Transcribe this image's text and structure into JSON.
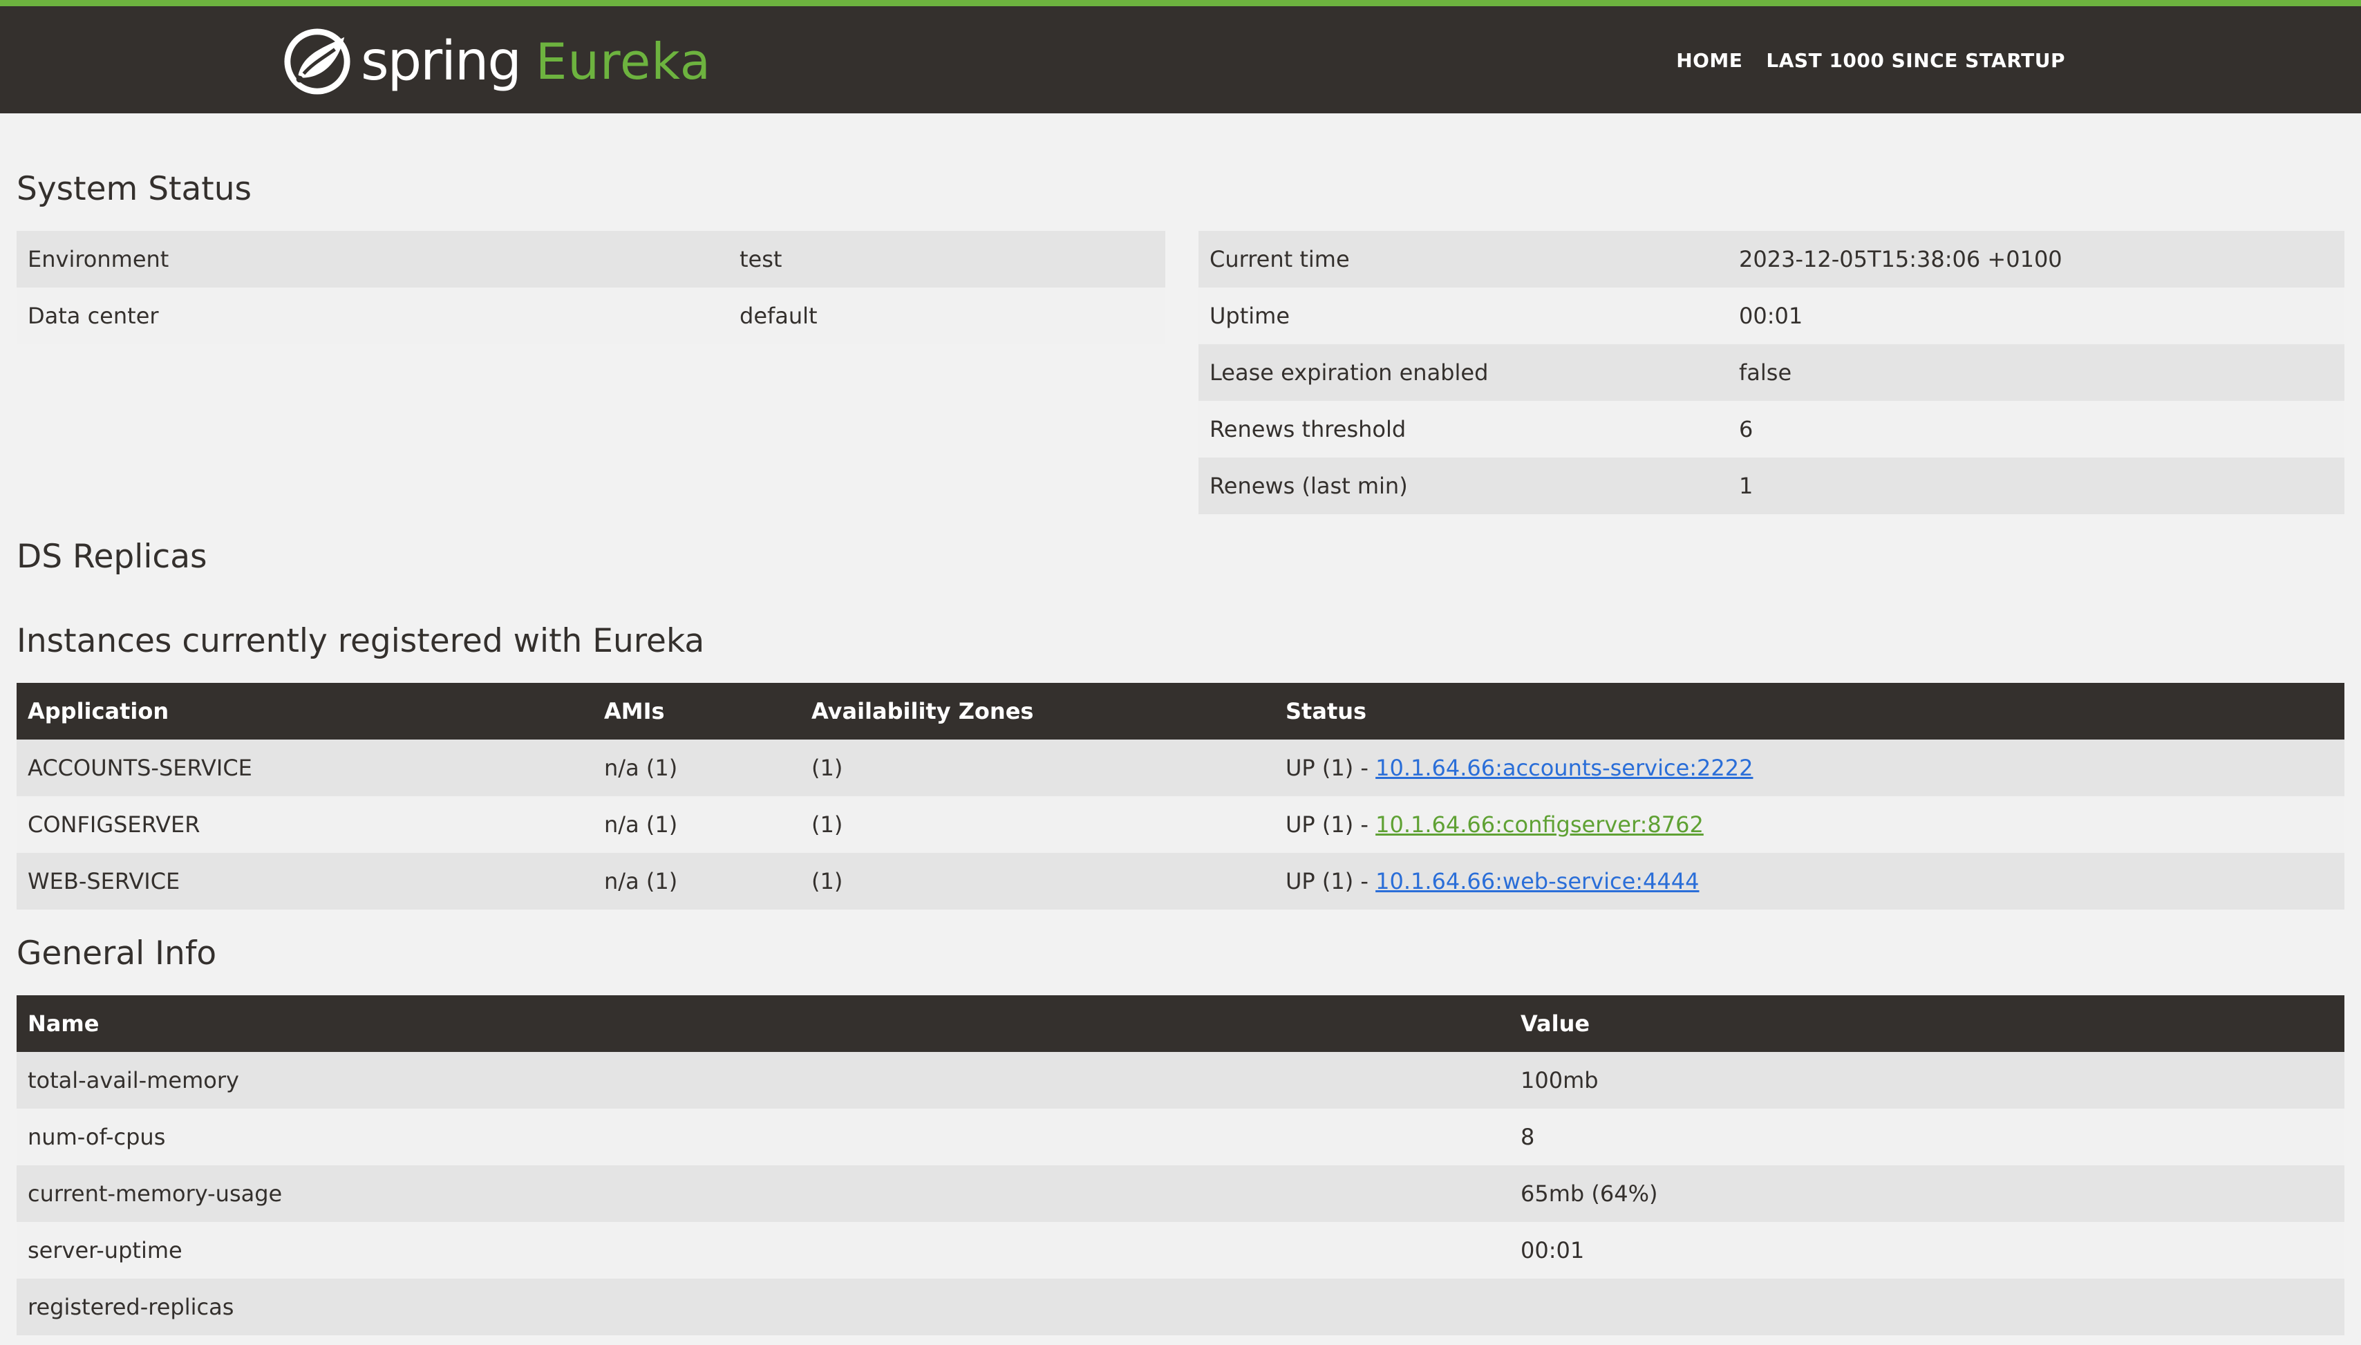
{
  "header": {
    "brand_primary": "spring",
    "brand_secondary": "Eureka",
    "nav": [
      {
        "label": "HOME"
      },
      {
        "label": "LAST 1000 SINCE STARTUP"
      }
    ],
    "accent_color": "#6db33f",
    "bar_color": "#34302d"
  },
  "system_status": {
    "title": "System Status",
    "left_rows": [
      {
        "name": "Environment",
        "value": "test"
      },
      {
        "name": "Data center",
        "value": "default"
      }
    ],
    "right_rows": [
      {
        "name": "Current time",
        "value": "2023-12-05T15:38:06 +0100"
      },
      {
        "name": "Uptime",
        "value": "00:01"
      },
      {
        "name": "Lease expiration enabled",
        "value": "false"
      },
      {
        "name": "Renews threshold",
        "value": "6"
      },
      {
        "name": "Renews (last min)",
        "value": "1"
      }
    ]
  },
  "ds_replicas": {
    "title": "DS Replicas"
  },
  "instances": {
    "title": "Instances currently registered with Eureka",
    "columns": [
      "Application",
      "AMIs",
      "Availability Zones",
      "Status"
    ],
    "rows": [
      {
        "application": "ACCOUNTS-SERVICE",
        "amis": "n/a (1)",
        "zones": "(1)",
        "status_prefix": "UP (1) - ",
        "link": "10.1.64.66:accounts-service:2222"
      },
      {
        "application": "CONFIGSERVER",
        "amis": "n/a (1)",
        "zones": "(1)",
        "status_prefix": "UP (1) - ",
        "link": "10.1.64.66:configserver:8762"
      },
      {
        "application": "WEB-SERVICE",
        "amis": "n/a (1)",
        "zones": "(1)",
        "status_prefix": "UP (1) - ",
        "link": "10.1.64.66:web-service:4444"
      }
    ]
  },
  "general_info": {
    "title": "General Info",
    "columns": [
      "Name",
      "Value"
    ],
    "rows": [
      {
        "name": "total-avail-memory",
        "value": "100mb"
      },
      {
        "name": "num-of-cpus",
        "value": "8"
      },
      {
        "name": "current-memory-usage",
        "value": "65mb (64%)"
      },
      {
        "name": "server-uptime",
        "value": "00:01"
      },
      {
        "name": "registered-replicas",
        "value": ""
      }
    ]
  }
}
